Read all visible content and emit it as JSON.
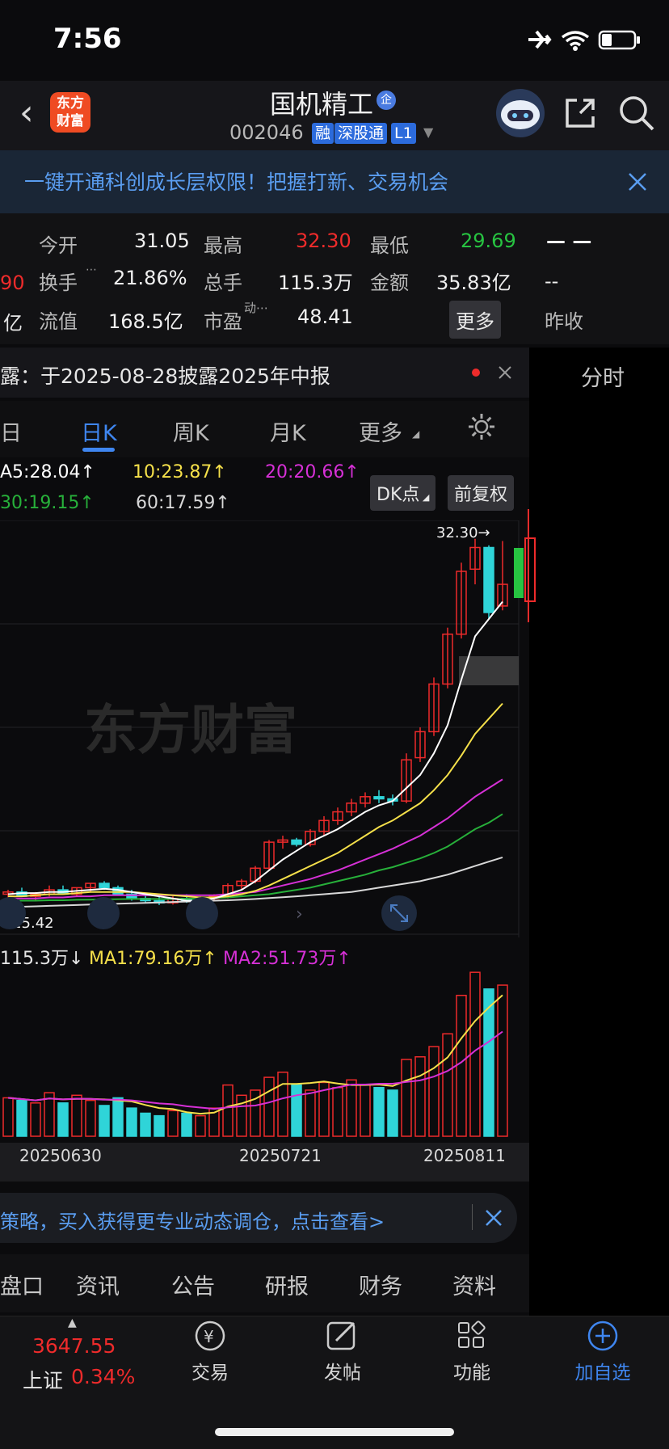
{
  "status": {
    "time": "7:56"
  },
  "header": {
    "logo_line1": "东方",
    "logo_line2": "财富",
    "stock_name": "国机精工",
    "qi_badge": "企",
    "code": "002046",
    "tags": [
      "融",
      "深股通",
      "L1"
    ]
  },
  "banner": {
    "text": "一键开通科创成长层权限！把握打新、交易机会"
  },
  "quote": {
    "left_values": [
      "90",
      "亿"
    ],
    "rows": [
      [
        {
          "label": "今开",
          "value": "31.05",
          "color": "white"
        },
        {
          "label": "最高",
          "value": "32.30",
          "color": "red"
        },
        {
          "label": "最低",
          "value": "29.69",
          "color": "green"
        }
      ],
      [
        {
          "label": "换手",
          "value": "21.86%",
          "color": "white"
        },
        {
          "label": "总手",
          "value": "115.3万",
          "color": "white"
        },
        {
          "label": "金额",
          "value": "35.83亿",
          "color": "white"
        }
      ],
      [
        {
          "label": "流值",
          "value": "168.5亿",
          "color": "white"
        },
        {
          "label": "市盈",
          "value": "48.41",
          "color": "white"
        }
      ]
    ],
    "more": "更多",
    "right_top": "— —",
    "right_mid": "--",
    "right_bot": "昨收"
  },
  "notice": {
    "text": "露：于2025-08-28披露2025年中报"
  },
  "side": {
    "label": "分时"
  },
  "tabs": [
    "日",
    "日K",
    "周K",
    "月K",
    "更多"
  ],
  "ma": {
    "ma5": "A5:28.04↑",
    "ma10": "10:23.87↑",
    "ma20": "20:20.66↑",
    "ma30": "30:19.15↑",
    "ma60": "60:17.59↑",
    "dk": "DK点",
    "fq": "前复权"
  },
  "chart_labels": {
    "high": "32.30→",
    "low": "←15.42",
    "watermark": "东方财富"
  },
  "volume": {
    "vol": "115.3万↓",
    "ma1": "MA1:79.16万↑",
    "ma2": "MA2:51.73万↑",
    "dates": [
      "20250630",
      "20250721",
      "20250811"
    ]
  },
  "ad": {
    "text": "策略，买入获得更专业动态调仓，点击查看>"
  },
  "subtabs": [
    "盘口",
    "资讯",
    "公告",
    "研报",
    "财务",
    "资料"
  ],
  "nav": {
    "index_value": "3647.55",
    "index_name": "上证",
    "index_pct": "0.34%",
    "items": [
      "交易",
      "发帖",
      "功能",
      "加自选"
    ]
  },
  "colors": {
    "up": "#ee2b2b",
    "down": "#2fd4d8",
    "ma5": "#ffffff",
    "ma10": "#f5e04a",
    "ma20": "#d630d6",
    "ma30": "#27b03a",
    "ma60": "#d8d8d8",
    "accent": "#3f86f0"
  },
  "chart_data": {
    "type": "candlestick",
    "title": "",
    "xlabel": "",
    "ylabel": "",
    "x_ticks": [
      "20250630",
      "20250721",
      "20250811"
    ],
    "high": 32.3,
    "low": 15.42,
    "ylim": [
      14.5,
      33.0
    ],
    "ohlc": [
      [
        15.9,
        16.1,
        15.7,
        16.0
      ],
      [
        16.0,
        16.2,
        15.8,
        15.8
      ],
      [
        15.8,
        16.0,
        15.6,
        15.9
      ],
      [
        15.9,
        16.3,
        15.8,
        16.1
      ],
      [
        16.1,
        16.3,
        15.9,
        15.9
      ],
      [
        15.9,
        16.2,
        15.8,
        16.2
      ],
      [
        16.2,
        16.4,
        16.0,
        16.4
      ],
      [
        16.4,
        16.5,
        16.1,
        16.2
      ],
      [
        16.2,
        16.3,
        15.9,
        15.9
      ],
      [
        15.9,
        16.1,
        15.6,
        15.7
      ],
      [
        15.7,
        15.9,
        15.5,
        15.6
      ],
      [
        15.6,
        15.8,
        15.4,
        15.5
      ],
      [
        15.5,
        15.8,
        15.42,
        15.7
      ],
      [
        15.7,
        15.9,
        15.5,
        15.6
      ],
      [
        15.6,
        15.8,
        15.5,
        15.7
      ],
      [
        15.7,
        15.9,
        15.6,
        15.8
      ],
      [
        15.8,
        16.4,
        15.7,
        16.3
      ],
      [
        16.3,
        16.6,
        16.1,
        16.5
      ],
      [
        16.5,
        17.2,
        16.4,
        17.1
      ],
      [
        17.1,
        18.4,
        17.0,
        18.3
      ],
      [
        18.3,
        18.6,
        18.0,
        18.4
      ],
      [
        18.4,
        18.5,
        18.1,
        18.2
      ],
      [
        18.2,
        18.9,
        18.1,
        18.8
      ],
      [
        18.8,
        19.5,
        18.6,
        19.3
      ],
      [
        19.3,
        19.9,
        19.1,
        19.7
      ],
      [
        19.7,
        20.3,
        19.5,
        20.1
      ],
      [
        20.1,
        20.6,
        19.9,
        20.4
      ],
      [
        20.4,
        20.7,
        20.1,
        20.3
      ],
      [
        20.3,
        20.5,
        20.0,
        20.2
      ],
      [
        20.2,
        22.4,
        20.1,
        22.1
      ],
      [
        22.2,
        23.6,
        22.0,
        23.4
      ],
      [
        23.4,
        25.9,
        23.2,
        25.6
      ],
      [
        25.6,
        28.2,
        25.4,
        27.9
      ],
      [
        27.9,
        31.2,
        27.7,
        30.8
      ],
      [
        30.9,
        32.3,
        30.2,
        31.9
      ],
      [
        31.9,
        32.0,
        28.6,
        28.9
      ],
      [
        29.2,
        32.2,
        29.0,
        30.2
      ]
    ],
    "volume": [
      30,
      28,
      26,
      34,
      26,
      32,
      28,
      24,
      30,
      22,
      18,
      16,
      20,
      18,
      16,
      22,
      40,
      32,
      36,
      46,
      50,
      40,
      36,
      42,
      38,
      44,
      40,
      38,
      36,
      60,
      62,
      70,
      80,
      110,
      128,
      115,
      118
    ],
    "ma5": [
      15.9,
      15.95,
      15.95,
      16.0,
      16.0,
      16.05,
      16.1,
      16.15,
      16.1,
      16.0,
      15.9,
      15.8,
      15.7,
      15.6,
      15.6,
      15.7,
      15.9,
      16.1,
      16.5,
      17.0,
      17.5,
      17.9,
      18.3,
      18.6,
      18.9,
      19.3,
      19.7,
      20.0,
      20.2,
      20.8,
      21.4,
      22.4,
      23.7,
      25.8,
      27.8,
      28.6,
      29.4
    ],
    "ma10": [
      15.8,
      15.8,
      15.85,
      15.9,
      15.9,
      15.95,
      16.0,
      16.0,
      16.0,
      16.0,
      15.95,
      15.9,
      15.85,
      15.8,
      15.75,
      15.75,
      15.8,
      15.9,
      16.05,
      16.3,
      16.6,
      16.9,
      17.2,
      17.5,
      17.8,
      18.2,
      18.6,
      19.0,
      19.3,
      19.7,
      20.1,
      20.7,
      21.4,
      22.3,
      23.3,
      24.0,
      24.7
    ],
    "ma20": [
      15.7,
      15.7,
      15.7,
      15.75,
      15.75,
      15.8,
      15.8,
      15.85,
      15.85,
      15.85,
      15.85,
      15.85,
      15.85,
      15.85,
      15.85,
      15.85,
      15.9,
      15.95,
      16.0,
      16.15,
      16.3,
      16.45,
      16.6,
      16.8,
      17.0,
      17.25,
      17.5,
      17.75,
      18.0,
      18.3,
      18.6,
      19.0,
      19.4,
      19.9,
      20.4,
      20.8,
      21.2
    ],
    "ma30": [
      15.6,
      15.6,
      15.6,
      15.62,
      15.62,
      15.64,
      15.65,
      15.66,
      15.67,
      15.68,
      15.68,
      15.68,
      15.68,
      15.69,
      15.7,
      15.72,
      15.75,
      15.8,
      15.85,
      15.9,
      16.0,
      16.1,
      16.2,
      16.35,
      16.5,
      16.65,
      16.8,
      17.0,
      17.15,
      17.35,
      17.55,
      17.8,
      18.1,
      18.5,
      18.9,
      19.2,
      19.6
    ],
    "ma60": [
      15.3,
      15.32,
      15.34,
      15.36,
      15.38,
      15.4,
      15.42,
      15.44,
      15.46,
      15.48,
      15.5,
      15.52,
      15.54,
      15.56,
      15.58,
      15.6,
      15.62,
      15.65,
      15.68,
      15.72,
      15.76,
      15.8,
      15.85,
      15.9,
      15.95,
      16.0,
      16.1,
      16.2,
      16.3,
      16.4,
      16.5,
      16.65,
      16.8,
      17.0,
      17.2,
      17.4,
      17.6
    ]
  }
}
